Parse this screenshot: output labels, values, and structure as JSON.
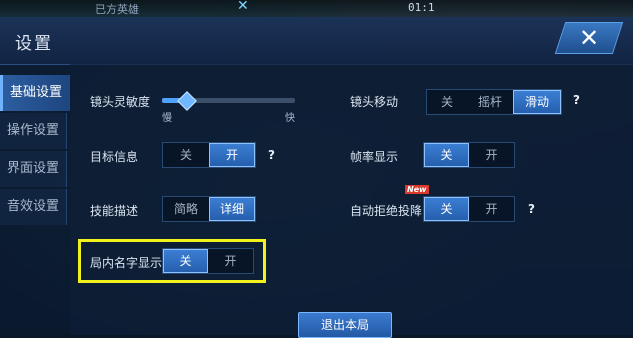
{
  "background": {
    "hero_label": "已方英雄",
    "time": "01:1",
    "x_glyph": "✕"
  },
  "panel": {
    "title": "设置",
    "close_glyph": "✕"
  },
  "sidebar": {
    "items": [
      {
        "label": "基础设置",
        "active": true
      },
      {
        "label": "操作设置",
        "active": false
      },
      {
        "label": "界面设置",
        "active": false
      },
      {
        "label": "音效设置",
        "active": false
      }
    ]
  },
  "settings": {
    "camera_sensitivity": {
      "label": "镜头灵敏度",
      "min_label": "慢",
      "max_label": "快",
      "value": 0.18
    },
    "camera_move": {
      "label": "镜头移动",
      "options": [
        "关",
        "摇杆",
        "滑动"
      ],
      "selected": "滑动",
      "help": "?"
    },
    "target_info": {
      "label": "目标信息",
      "options": [
        "关",
        "开"
      ],
      "selected": "开",
      "help": "?"
    },
    "fps_display": {
      "label": "帧率显示",
      "options": [
        "关",
        "开"
      ],
      "selected": "关"
    },
    "skill_desc": {
      "label": "技能描述",
      "options": [
        "简略",
        "详细"
      ],
      "selected": "详细"
    },
    "auto_reject_surrender": {
      "label": "自动拒绝投降",
      "badge": "New",
      "options": [
        "关",
        "开"
      ],
      "selected": "关",
      "help": "?"
    },
    "in_game_name_display": {
      "label": "局内名字显示",
      "options": [
        "关",
        "开"
      ],
      "selected": "关"
    }
  },
  "footer": {
    "quit_label": "退出本局"
  },
  "colors": {
    "accent": "#3b7ed3",
    "highlight_border": "#f2f21a",
    "new_badge": "#d93a2e"
  }
}
